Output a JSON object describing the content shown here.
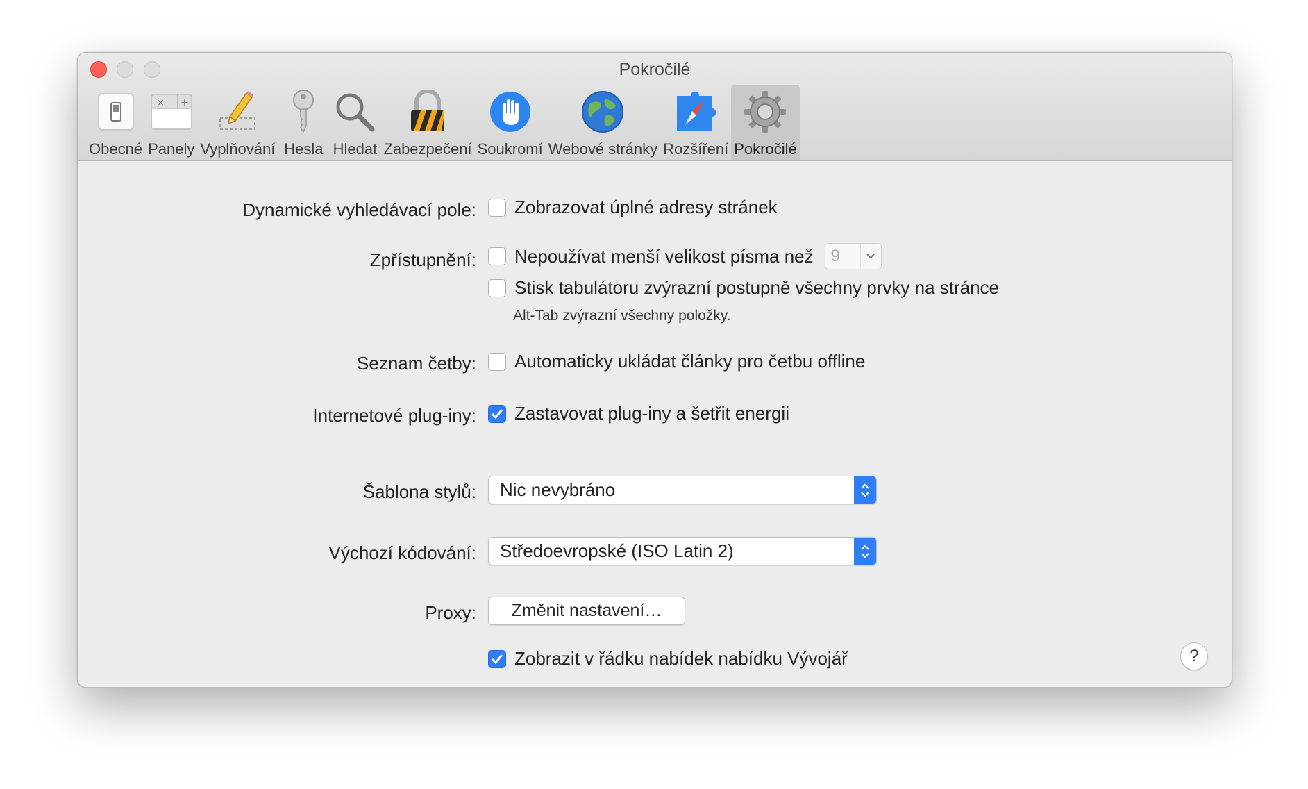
{
  "window": {
    "title": "Pokročilé",
    "traffic_lights": {
      "close": "close-button",
      "minimize": "minimize-button",
      "zoom": "zoom-button"
    }
  },
  "toolbar": {
    "active": "Pokročilé",
    "items": [
      {
        "label": "Obecné",
        "icon": "switch-icon"
      },
      {
        "label": "Panely",
        "icon": "tabs-icon"
      },
      {
        "label": "Vyplňování",
        "icon": "pencil-icon"
      },
      {
        "label": "Hesla",
        "icon": "key-icon"
      },
      {
        "label": "Hledat",
        "icon": "magnifier-icon"
      },
      {
        "label": "Zabezpečení",
        "icon": "padlock-icon"
      },
      {
        "label": "Soukromí",
        "icon": "hand-icon"
      },
      {
        "label": "Webové stránky",
        "icon": "globe-icon"
      },
      {
        "label": "Rozšíření",
        "icon": "puzzle-compass-icon"
      },
      {
        "label": "Pokročilé",
        "icon": "gear-icon"
      }
    ]
  },
  "settings": {
    "smart_search": {
      "label": "Dynamické vyhledávací pole:",
      "option": "Zobrazovat úplné adresy stránek",
      "checked": false
    },
    "accessibility": {
      "label": "Zpřístupnění:",
      "min_font_option": "Nepoužívat menší velikost písma než",
      "min_font_checked": false,
      "min_font_value": "9",
      "tab_option": "Stisk tabulátoru zvýrazní postupně všechny prvky na stránce",
      "tab_checked": false,
      "tab_hint": "Alt-Tab zvýrazní všechny položky."
    },
    "reading_list": {
      "label": "Seznam četby:",
      "option": "Automaticky ukládat články pro četbu offline",
      "checked": false
    },
    "plugins": {
      "label": "Internetové plug-iny:",
      "option": "Zastavovat plug-iny a šetřit energii",
      "checked": true
    },
    "style_sheet": {
      "label": "Šablona stylů:",
      "value": "Nic nevybráno"
    },
    "encoding": {
      "label": "Výchozí kódování:",
      "value": "Středoevropské (ISO Latin 2)"
    },
    "proxy": {
      "label": "Proxy:",
      "button": "Změnit nastavení…"
    },
    "develop_menu": {
      "option": "Zobrazit v řádku nabídek nabídku Vývojář",
      "checked": true
    },
    "help": "?"
  },
  "colors": {
    "accent": "#2f7ef5",
    "close": "#fe5f57",
    "window_bg": "#ececec"
  }
}
